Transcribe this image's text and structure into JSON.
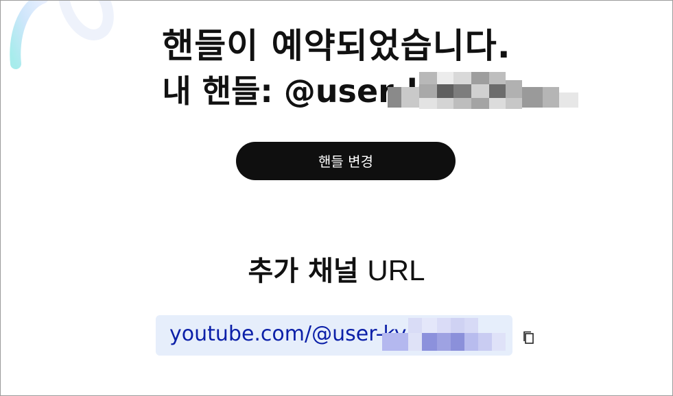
{
  "confirmation": {
    "title": "핸들이 예약되었습니다.",
    "handle_prefix": "내 핸들: ",
    "handle_value": "@user-ky      l1c"
  },
  "actions": {
    "change_handle_label": "핸들 변경"
  },
  "extra_channel": {
    "heading_bold": "추가 채널",
    "heading_normal": "URL",
    "url_value": "youtube.com/@user-ky      l1c"
  },
  "icons": {
    "decoration": "swirl-decoration-icon",
    "copy": "copy-icon"
  },
  "colors": {
    "button_bg": "#0f0f0f",
    "button_text": "#ffffff",
    "url_box_bg": "#e6eefb",
    "url_text": "#0b1fa8"
  }
}
